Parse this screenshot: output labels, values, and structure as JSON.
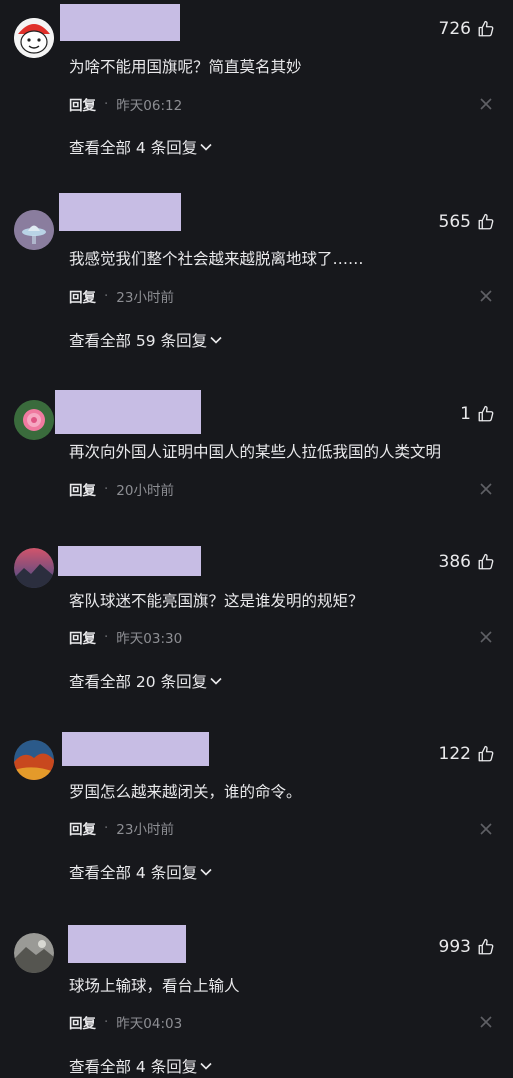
{
  "comments": [
    {
      "likes": "726",
      "text": "为啥不能用国旗呢？简直莫名其妙",
      "reply_label": "回复",
      "time": "昨天06:12",
      "expand_label": "查看全部 4 条回复",
      "avatar_icon": "cartoon-avatar-icon"
    },
    {
      "likes": "565",
      "text": "我感觉我们整个社会越来越脱离地球了……",
      "reply_label": "回复",
      "time": "23小时前",
      "expand_label": "查看全部 59 条回复",
      "avatar_icon": "ufo-avatar-icon"
    },
    {
      "likes": "1",
      "text": "再次向外国人证明中国人的某些人拉低我国的人类文明",
      "reply_label": "回复",
      "time": "20小时前",
      "expand_label": "",
      "avatar_icon": "flower-avatar-icon"
    },
    {
      "likes": "386",
      "text": "客队球迷不能亮国旗？这是谁发明的规矩？",
      "reply_label": "回复",
      "time": "昨天03:30",
      "expand_label": "查看全部 20 条回复",
      "avatar_icon": "landscape-avatar-icon"
    },
    {
      "likes": "122",
      "text": "罗国怎么越来越闭关，谁的命令。",
      "reply_label": "回复",
      "time": "23小时前",
      "expand_label": "查看全部 4 条回复",
      "avatar_icon": "autumn-avatar-icon"
    },
    {
      "likes": "993",
      "text": "球场上输球，看台上输人",
      "reply_label": "回复",
      "time": "昨天04:03",
      "expand_label": "查看全部 4 条回复",
      "avatar_icon": "photo-avatar-icon"
    }
  ],
  "colors": {
    "background": "#17181c",
    "redacted_name": "#c7bde4",
    "text": "#e9e9eb",
    "meta": "#8d8e93"
  }
}
